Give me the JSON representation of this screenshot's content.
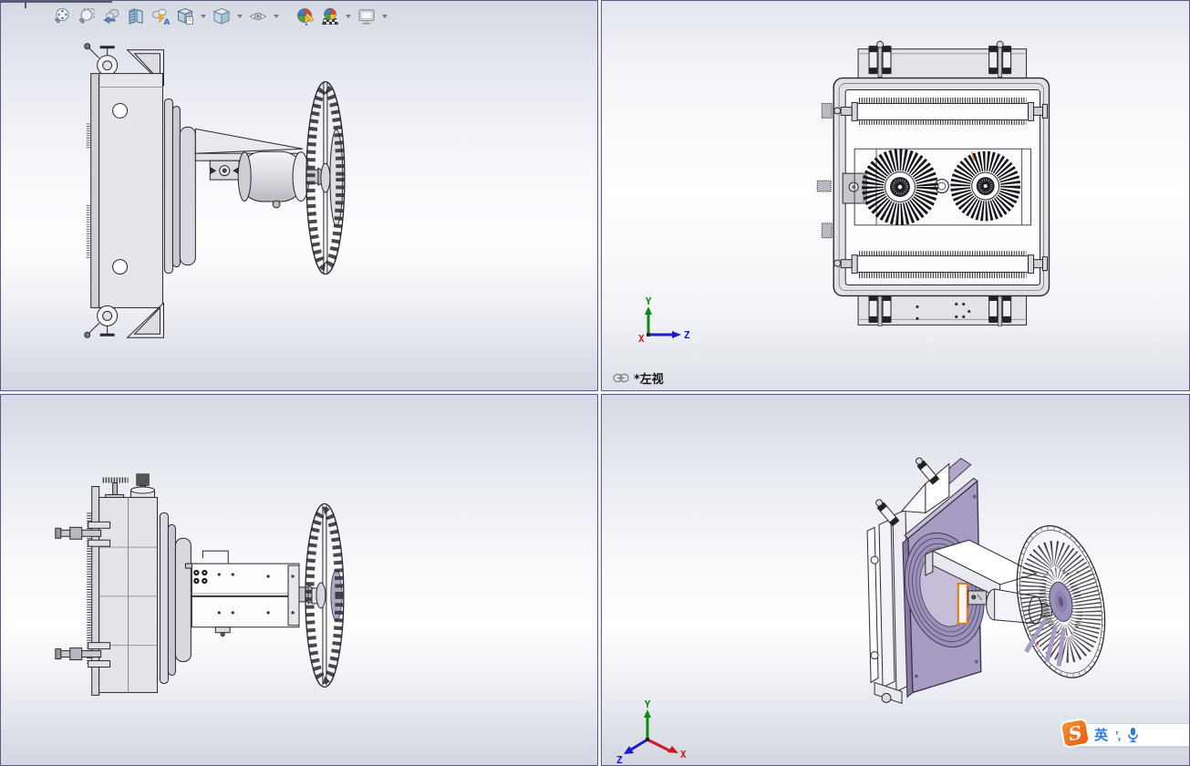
{
  "heads_up_toolbar": {
    "buttons": [
      {
        "icon": "zoom-to-fit-icon",
        "dropdown": false
      },
      {
        "icon": "zoom-to-area-icon",
        "dropdown": false
      },
      {
        "icon": "previous-view-icon",
        "dropdown": false
      },
      {
        "icon": "section-view-icon",
        "dropdown": false
      },
      {
        "icon": "dynamic-annotation-views-icon",
        "dropdown": false
      },
      {
        "icon": "view-orientation-icon",
        "dropdown": true
      },
      {
        "icon": "display-style-icon",
        "dropdown": true
      },
      {
        "icon": "hide-show-items-icon",
        "dropdown": true
      },
      {
        "icon": "edit-appearance-icon",
        "dropdown": false,
        "group_gap": true
      },
      {
        "icon": "apply-scene-icon",
        "dropdown": true
      },
      {
        "icon": "view-settings-icon",
        "dropdown": true
      }
    ]
  },
  "viewports": {
    "top_right": {
      "view_label": "*左视",
      "triad": {
        "up_axis": "Y",
        "right_axis": "Z",
        "origin_axis": "X"
      }
    },
    "bottom_right": {
      "triad": {
        "up_axis": "Y",
        "right_down_axis": "X",
        "left_down_axis": "Z"
      }
    }
  },
  "ime_bar": {
    "logo_letter": "S",
    "mode_label": "英",
    "punctuation_label": "’,"
  },
  "colors": {
    "axis_x": "#cc1a1a",
    "axis_y": "#0e8a0e",
    "axis_z": "#1b1bcf",
    "selection_highlight": "#e07818",
    "part_purple": "#a89cc2",
    "viewport_border": "#5a5a82"
  }
}
